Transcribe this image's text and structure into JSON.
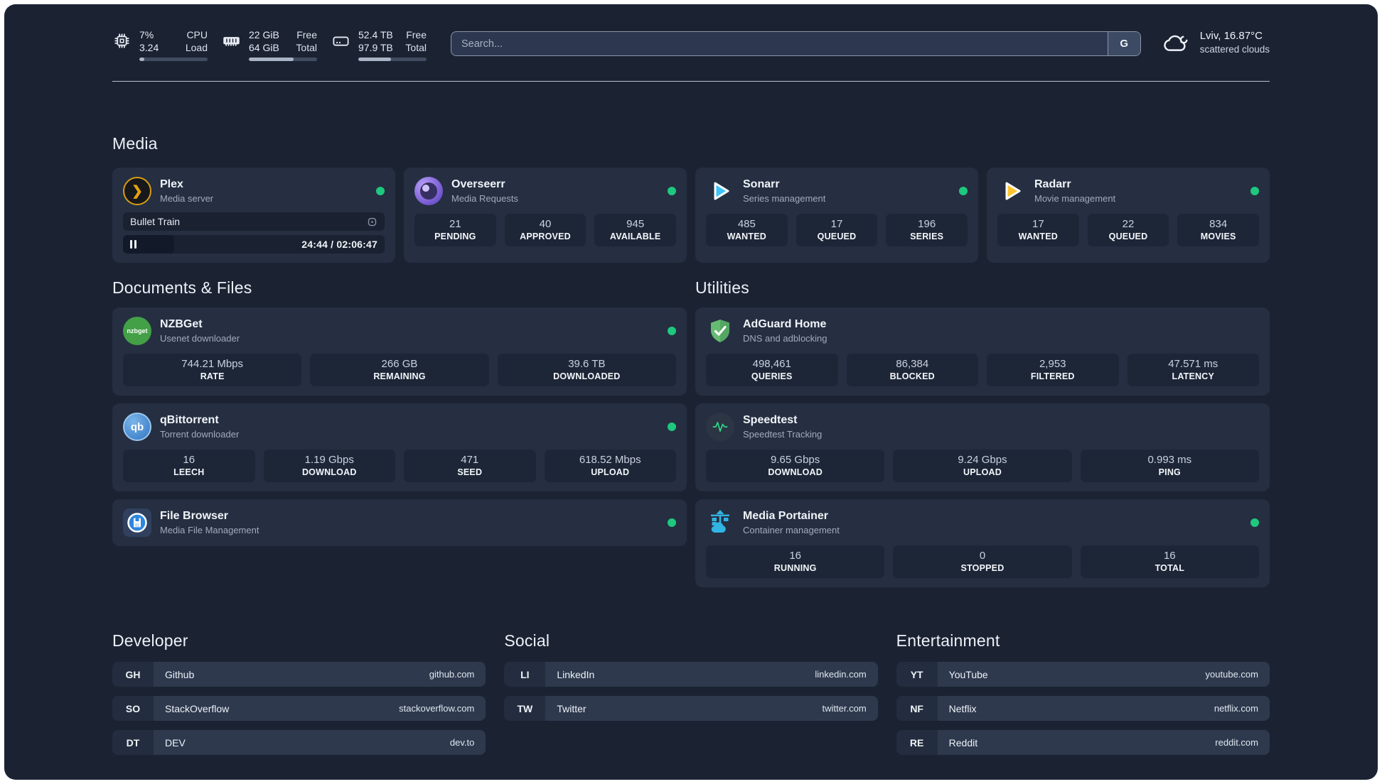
{
  "header": {
    "system_stats": [
      {
        "name": "cpu",
        "values": [
          "7%",
          "3.24"
        ],
        "labels": [
          "CPU",
          "Load"
        ],
        "progress_pct": 7
      },
      {
        "name": "memory",
        "values": [
          "22 GiB",
          "64 GiB"
        ],
        "labels": [
          "Free",
          "Total"
        ],
        "progress_pct": 66
      },
      {
        "name": "storage",
        "values": [
          "52.4 TB",
          "97.9 TB"
        ],
        "labels": [
          "Free",
          "Total"
        ],
        "progress_pct": 48
      }
    ],
    "search": {
      "placeholder": "Search...",
      "engine_button": "G"
    },
    "weather": {
      "location_temperature": "Lviv, 16.87°C",
      "condition": "scattered clouds"
    }
  },
  "sections": {
    "media": {
      "title": "Media",
      "apps": {
        "plex": {
          "name": "Plex",
          "subtitle": "Media server",
          "status": "online",
          "now_playing": {
            "title": "Bullet Train",
            "time": "24:44 / 02:06:47",
            "progress_pct": 19.5
          }
        },
        "overseerr": {
          "name": "Overseerr",
          "subtitle": "Media Requests",
          "status": "online",
          "stats": [
            {
              "value": "21",
              "label": "PENDING"
            },
            {
              "value": "40",
              "label": "APPROVED"
            },
            {
              "value": "945",
              "label": "AVAILABLE"
            }
          ]
        },
        "sonarr": {
          "name": "Sonarr",
          "subtitle": "Series management",
          "status": "online",
          "stats": [
            {
              "value": "485",
              "label": "WANTED"
            },
            {
              "value": "17",
              "label": "QUEUED"
            },
            {
              "value": "196",
              "label": "SERIES"
            }
          ]
        },
        "radarr": {
          "name": "Radarr",
          "subtitle": "Movie management",
          "status": "online",
          "stats": [
            {
              "value": "17",
              "label": "WANTED"
            },
            {
              "value": "22",
              "label": "QUEUED"
            },
            {
              "value": "834",
              "label": "MOVIES"
            }
          ]
        }
      }
    },
    "documents": {
      "title": "Documents & Files",
      "apps": {
        "nzbget": {
          "name": "NZBGet",
          "subtitle": "Usenet downloader",
          "status": "online",
          "logo_text": "nzbget",
          "stats": [
            {
              "value": "744.21 Mbps",
              "label": "RATE"
            },
            {
              "value": "266 GB",
              "label": "REMAINING"
            },
            {
              "value": "39.6 TB",
              "label": "DOWNLOADED"
            }
          ]
        },
        "qbittorrent": {
          "name": "qBittorrent",
          "subtitle": "Torrent downloader",
          "status": "online",
          "logo_text": "qb",
          "stats": [
            {
              "value": "16",
              "label": "LEECH"
            },
            {
              "value": "1.19 Gbps",
              "label": "DOWNLOAD"
            },
            {
              "value": "471",
              "label": "SEED"
            },
            {
              "value": "618.52 Mbps",
              "label": "UPLOAD"
            }
          ]
        },
        "filebrowser": {
          "name": "File Browser",
          "subtitle": "Media File Management",
          "status": "online"
        }
      }
    },
    "utilities": {
      "title": "Utilities",
      "apps": {
        "adguard": {
          "name": "AdGuard Home",
          "subtitle": "DNS and adblocking",
          "stats": [
            {
              "value": "498,461",
              "label": "QUERIES"
            },
            {
              "value": "86,384",
              "label": "BLOCKED"
            },
            {
              "value": "2,953",
              "label": "FILTERED"
            },
            {
              "value": "47.571 ms",
              "label": "LATENCY"
            }
          ]
        },
        "speedtest": {
          "name": "Speedtest",
          "subtitle": "Speedtest Tracking",
          "stats": [
            {
              "value": "9.65 Gbps",
              "label": "DOWNLOAD"
            },
            {
              "value": "9.24 Gbps",
              "label": "UPLOAD"
            },
            {
              "value": "0.993 ms",
              "label": "PING"
            }
          ]
        },
        "portainer": {
          "name": "Media Portainer",
          "subtitle": "Container management",
          "status": "online",
          "stats": [
            {
              "value": "16",
              "label": "RUNNING"
            },
            {
              "value": "0",
              "label": "STOPPED"
            },
            {
              "value": "16",
              "label": "TOTAL"
            }
          ]
        }
      }
    },
    "bookmarks": [
      {
        "title": "Developer",
        "items": [
          {
            "abbr": "GH",
            "name": "Github",
            "url": "github.com"
          },
          {
            "abbr": "SO",
            "name": "StackOverflow",
            "url": "stackoverflow.com"
          },
          {
            "abbr": "DT",
            "name": "DEV",
            "url": "dev.to"
          }
        ]
      },
      {
        "title": "Social",
        "items": [
          {
            "abbr": "LI",
            "name": "LinkedIn",
            "url": "linkedin.com"
          },
          {
            "abbr": "TW",
            "name": "Twitter",
            "url": "twitter.com"
          }
        ]
      },
      {
        "title": "Entertainment",
        "items": [
          {
            "abbr": "YT",
            "name": "YouTube",
            "url": "youtube.com"
          },
          {
            "abbr": "NF",
            "name": "Netflix",
            "url": "netflix.com"
          },
          {
            "abbr": "RE",
            "name": "Reddit",
            "url": "reddit.com"
          }
        ]
      }
    ]
  },
  "colors": {
    "background": "#1b2333",
    "card": "#252f41",
    "stat_box": "#1d2637",
    "status_online": "#1ec87e",
    "plex_accent": "#e5a00d",
    "sonarr_accent": "#3fc3f7",
    "radarr_accent": "#fdc42f",
    "adguard_accent": "#5fb370",
    "portainer_accent": "#32b4e4"
  }
}
